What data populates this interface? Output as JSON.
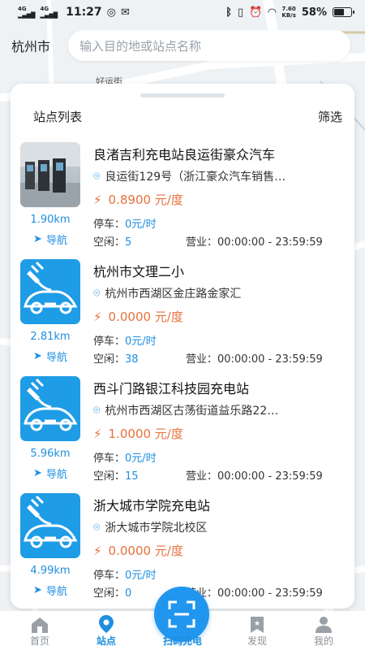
{
  "status_bar": {
    "network_1": "4G",
    "network_2": "4G",
    "time": "11:27",
    "speed_value": "7.60",
    "speed_unit": "KB/s",
    "battery": "58%",
    "battery_level": 0.58
  },
  "header": {
    "city": "杭州市",
    "search_placeholder": "输入目的地或站点名称"
  },
  "map": {
    "road_label": "好运街"
  },
  "panel": {
    "title": "站点列表",
    "filter_label": "筛选"
  },
  "stations": [
    {
      "name": "良渚吉利充电站良运街豪众汽车",
      "address": "良运街129号（浙江豪众汽车销售…",
      "price": "0.8900 元/度",
      "distance": "1.90km",
      "nav_label": "导航",
      "parking_label": "停车：",
      "parking_value": "0元/时",
      "free_label": "空闲：",
      "free_value": "5",
      "hours_label": "营业：",
      "hours_value": "00:00:00 - 23:59:59",
      "thumbnail": "photo"
    },
    {
      "name": "杭州市文理二小",
      "address": "杭州市西湖区金庄路金家汇",
      "price": "0.0000 元/度",
      "distance": "2.81km",
      "nav_label": "导航",
      "parking_label": "停车：",
      "parking_value": "0元/时",
      "free_label": "空闲：",
      "free_value": "38",
      "hours_label": "营业：",
      "hours_value": "00:00:00 - 23:59:59",
      "thumbnail": "ev-car-icon"
    },
    {
      "name": "西斗门路银江科技园充电站",
      "address": "杭州市西湖区古荡街道益乐路22…",
      "price": "1.0000 元/度",
      "distance": "5.96km",
      "nav_label": "导航",
      "parking_label": "停车：",
      "parking_value": "0元/时",
      "free_label": "空闲：",
      "free_value": "15",
      "hours_label": "营业：",
      "hours_value": "00:00:00 - 23:59:59",
      "thumbnail": "ev-car-icon"
    },
    {
      "name": "浙大城市学院充电站",
      "address": "浙大城市学院北校区",
      "price": "0.0000 元/度",
      "distance": "4.99km",
      "nav_label": "导航",
      "parking_label": "停车：",
      "parking_value": "0元/时",
      "free_label": "空闲：",
      "free_value": "0",
      "hours_label": "营业：",
      "hours_value": "00:00:00 - 23:59:59",
      "thumbnail": "ev-car-icon"
    }
  ],
  "bottom_nav": {
    "home": "首页",
    "stations": "站点",
    "scan": "扫码充电",
    "discover": "发现",
    "mine": "我的"
  },
  "colors": {
    "accent": "#1f8fe0",
    "price": "#e8713c",
    "scan_button": "#2196ee"
  }
}
